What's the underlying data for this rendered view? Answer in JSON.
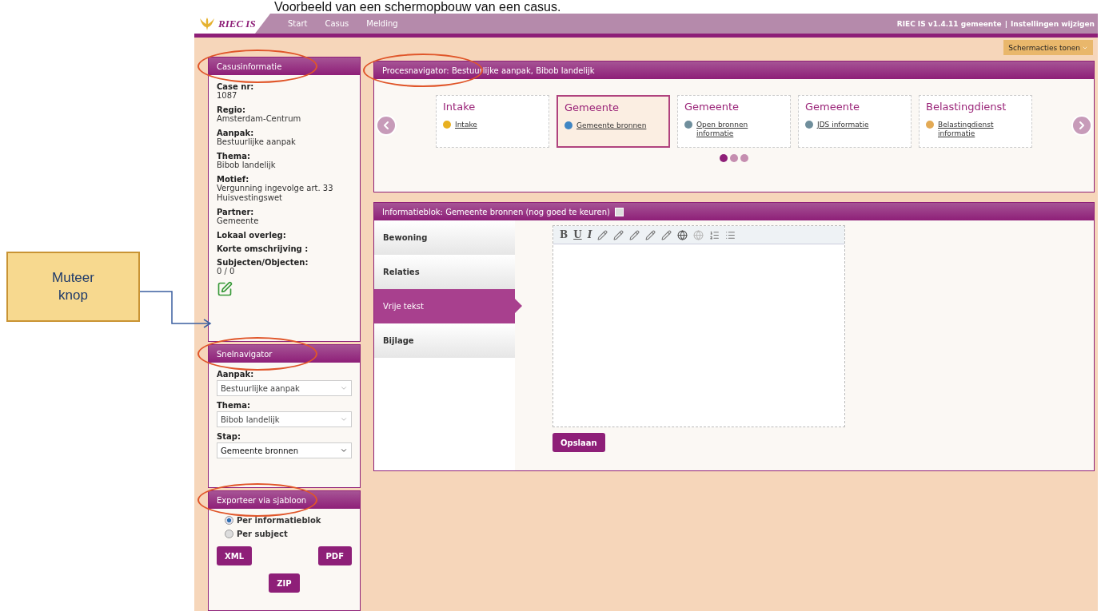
{
  "caption": "Voorbeeld van een schermopbouw van een casus.",
  "callout": {
    "label": "Muteer knop"
  },
  "navbar": {
    "logo": "RIEC IS",
    "items": [
      {
        "label": "Start"
      },
      {
        "label": "Casus"
      },
      {
        "label": "Melding"
      }
    ],
    "version": "RIEC IS v1.4.11 gemeente",
    "separator": "|",
    "settings_link": "Instellingen wijzigen"
  },
  "screen_actions": "Schermacties tonen",
  "casusinformatie": {
    "title": "Casusinformatie",
    "circled": true,
    "fields": [
      {
        "label": "Case nr:",
        "value": "1087"
      },
      {
        "label": "Regio:",
        "value": "Amsterdam-Centrum"
      },
      {
        "label": "Aanpak:",
        "value": "Bestuurlijke aanpak"
      },
      {
        "label": "Thema:",
        "value": "Bibob landelijk"
      },
      {
        "label": "Motief:",
        "value": "Vergunning ingevolge art. 33 Huisvestingswet"
      },
      {
        "label": "Partner:",
        "value": "Gemeente"
      },
      {
        "label": "Lokaal overleg:"
      },
      {
        "label": "Korte omschrijving :"
      },
      {
        "label": "Subjecten/Objecten:",
        "value": "0 / 0"
      }
    ]
  },
  "snelnavigator": {
    "title": "Snelnavigator",
    "circled": true,
    "fields": [
      {
        "label": "Aanpak:",
        "value": "Bestuurlijke aanpak",
        "kind": "light"
      },
      {
        "label": "Thema:",
        "value": "Bibob landelijk",
        "kind": "light"
      },
      {
        "label": "Stap:",
        "value": "Gemeente bronnen",
        "kind": "dark"
      }
    ]
  },
  "export": {
    "title": "Exporteer via sjabloon",
    "circled": true,
    "options": [
      {
        "label": "Per informatieblok",
        "selected": true
      },
      {
        "label": "Per subject",
        "selected": false
      }
    ],
    "buttons": [
      "XML",
      "PDF",
      "ZIP"
    ]
  },
  "procesnavigator": {
    "title": "Procesnavigator: Bestuurlijke aanpak, Bibob landelijk",
    "circled": true,
    "steps": [
      {
        "title": "Intake",
        "link": "Intake",
        "color": "#e8b020",
        "selected": false
      },
      {
        "title": "Gemeente",
        "link": "Gemeente bronnen",
        "color": "#3f86c4",
        "selected": true
      },
      {
        "title": "Gemeente",
        "link": "Open bronnen informatie",
        "color": "#6f8e9c",
        "selected": false
      },
      {
        "title": "Gemeente",
        "link": "JDS informatie",
        "color": "#6f8e9c",
        "selected": false
      },
      {
        "title": "Belastingdienst",
        "link": "Belastingdienst informatie",
        "color": "#e3aa55",
        "selected": false
      }
    ],
    "dots": [
      {
        "selected": true
      },
      {
        "selected": false
      },
      {
        "selected": false
      }
    ]
  },
  "informatieblok": {
    "title": "Informatieblok: Gemeente bronnen (nog goed te keuren)",
    "circled": false,
    "tabs": [
      {
        "label": "Bewoning",
        "selected": false
      },
      {
        "label": "Relaties",
        "selected": false
      },
      {
        "label": "Vrije tekst",
        "selected": true
      },
      {
        "label": "Bijlage",
        "selected": false
      }
    ],
    "toolbar_letters": [
      "B",
      "U",
      "I"
    ],
    "save": "Opslaan"
  }
}
